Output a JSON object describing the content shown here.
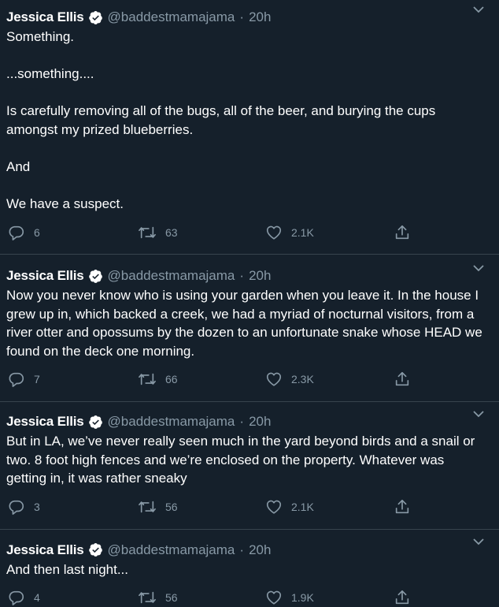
{
  "tweets": [
    {
      "name": "Jessica Ellis",
      "handle": "@baddestmamajama",
      "dot": "·",
      "time": "20h",
      "text": "Something.\n\n...something....\n\nIs carefully removing all of the bugs, all of the beer, and burying the cups amongst my prized blueberries.\n\nAnd\n\nWe have a suspect.",
      "replies": "6",
      "retweets": "63",
      "likes": "2.1K"
    },
    {
      "name": "Jessica Ellis",
      "handle": "@baddestmamajama",
      "dot": "·",
      "time": "20h",
      "text": "Now you never know who is using your garden when you leave it. In the house I grew up in, which backed a creek, we had a myriad of nocturnal visitors, from a river otter and opossums by the dozen to an unfortunate snake whose HEAD we found on the deck one morning.",
      "replies": "7",
      "retweets": "66",
      "likes": "2.3K"
    },
    {
      "name": "Jessica Ellis",
      "handle": "@baddestmamajama",
      "dot": "·",
      "time": "20h",
      "text": "But in LA, we’ve never really seen much in the yard beyond birds and a snail or two. 8 foot high fences and we’re enclosed on the property. Whatever was getting in, it was rather sneaky",
      "replies": "3",
      "retweets": "56",
      "likes": "2.1K"
    },
    {
      "name": "Jessica Ellis",
      "handle": "@baddestmamajama",
      "dot": "·",
      "time": "20h",
      "text": "And then last night...",
      "replies": "4",
      "retweets": "56",
      "likes": "1.9K"
    }
  ],
  "icons": {
    "verified": "verified-badge-icon",
    "caret": "chevron-down-icon",
    "reply": "reply-icon",
    "retweet": "retweet-icon",
    "like": "heart-icon",
    "share": "share-icon"
  },
  "colors": {
    "background": "#15202b",
    "text": "#ffffff",
    "muted": "#8899a6",
    "divider": "#38444d"
  }
}
